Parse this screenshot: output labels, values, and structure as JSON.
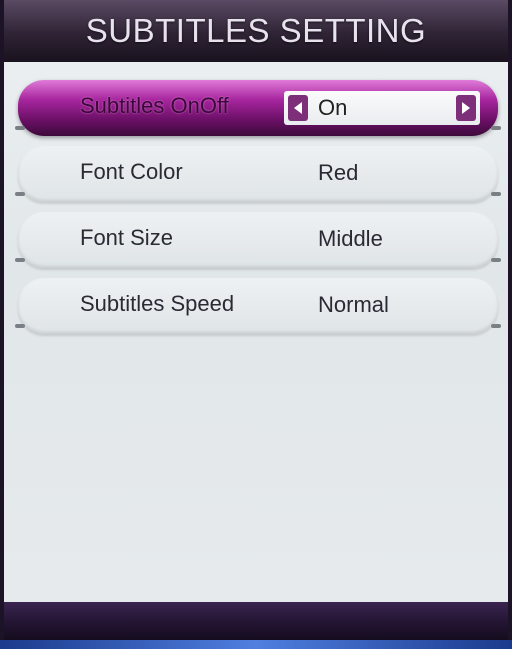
{
  "title": "SUBTITLES SETTING",
  "menu": {
    "items": [
      {
        "label": "Subtitles OnOff",
        "value": "On"
      },
      {
        "label": "Font Color",
        "value": "Red"
      },
      {
        "label": "Font Size",
        "value": "Middle"
      },
      {
        "label": "Subtitles Speed",
        "value": "Normal"
      }
    ]
  },
  "colors": {
    "accent": "#a7269f",
    "panel": "#e3e7ea",
    "frame": "#1c1426"
  },
  "icons": [
    "arrow-left-icon",
    "arrow-right-icon"
  ]
}
